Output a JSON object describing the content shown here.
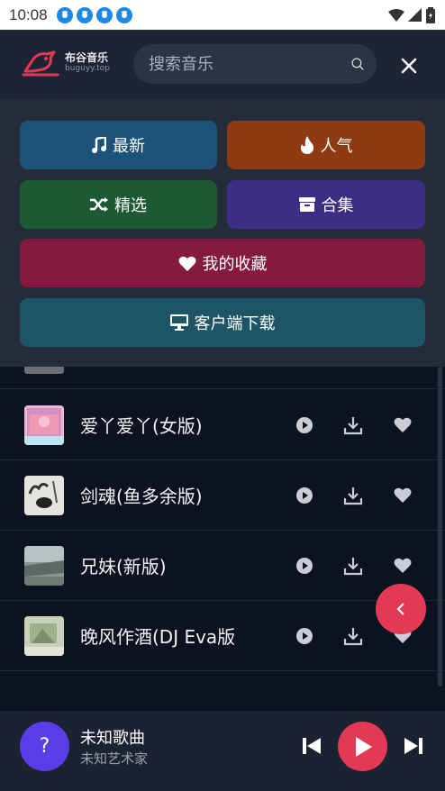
{
  "status_bar": {
    "time": "10:08"
  },
  "header": {
    "logo_title": "布谷音乐",
    "logo_sub": "buguyy.top",
    "search_placeholder": "搜索音乐"
  },
  "menu": {
    "latest": "最新",
    "popular": "人气",
    "selected": "精选",
    "collection": "合集",
    "favorites": "我的收藏",
    "client": "客户端下载"
  },
  "songs": [
    {
      "title": "爱丫爱丫(女版)"
    },
    {
      "title": "剑魂(鱼多余版)"
    },
    {
      "title": "兄妹(新版)"
    },
    {
      "title": "晚风作酒(DJ Eva版"
    }
  ],
  "player": {
    "avatar_text": "?",
    "title": "未知歌曲",
    "artist": "未知艺术家"
  },
  "colors": {
    "latest": "#1b5277",
    "popular": "#8f3a13",
    "selected": "#1d5a33",
    "collection": "#3a2f84",
    "favorites": "#86193f",
    "client": "#1d5566",
    "accent": "#e23a55"
  }
}
